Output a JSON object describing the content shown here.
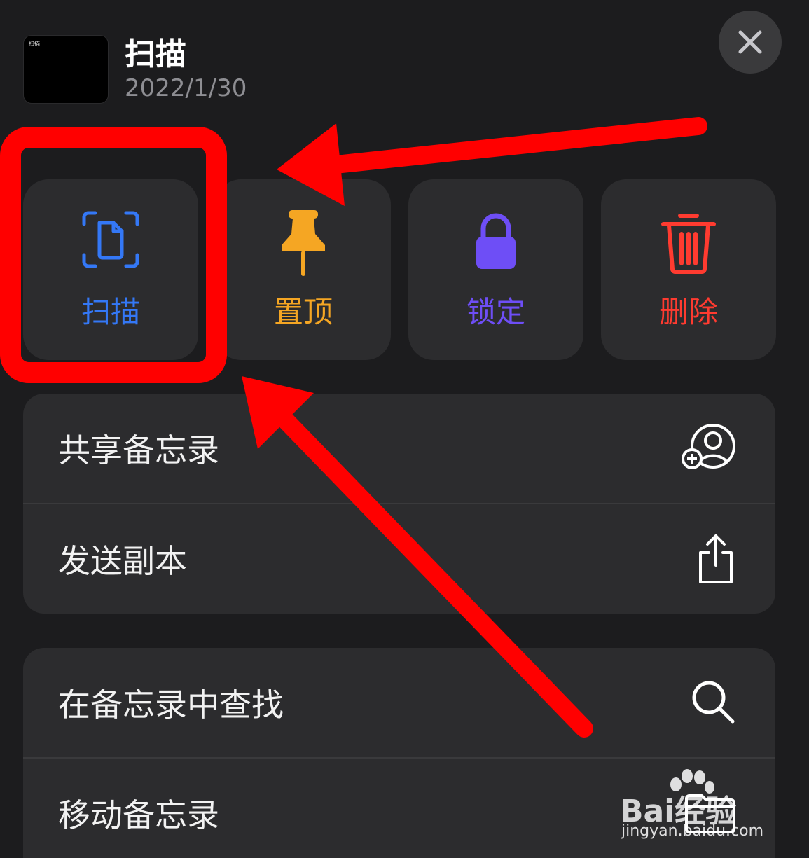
{
  "header": {
    "thumbnail_text": "扫描",
    "title": "扫描",
    "date": "2022/1/30",
    "close_icon": "close-icon"
  },
  "actions": [
    {
      "label": "扫描",
      "icon": "scan-document-icon",
      "color": "#3478f6"
    },
    {
      "label": "置顶",
      "icon": "pin-icon",
      "color": "#f5a623"
    },
    {
      "label": "锁定",
      "icon": "lock-icon",
      "color": "#6e4ef6"
    },
    {
      "label": "删除",
      "icon": "trash-icon",
      "color": "#ff3b30"
    }
  ],
  "menu_groups": [
    {
      "items": [
        {
          "label": "共享备忘录",
          "icon": "share-person-add-icon"
        },
        {
          "label": "发送副本",
          "icon": "share-upload-icon"
        }
      ]
    },
    {
      "items": [
        {
          "label": "在备忘录中查找",
          "icon": "search-icon"
        },
        {
          "label": "移动备忘录",
          "icon": "folder-icon"
        }
      ]
    }
  ],
  "annotation_color": "#ff0000",
  "watermark": {
    "brand": "Bai经验",
    "url": "jingyan.baidu.com"
  }
}
